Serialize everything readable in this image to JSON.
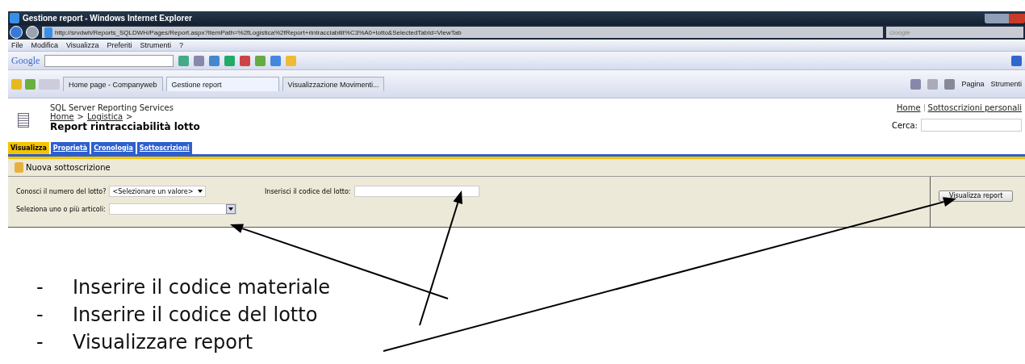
{
  "window": {
    "title": "Gestione report - Windows Internet Explorer"
  },
  "address_bar": {
    "url": "http://srvdwh/Reports_SQLDWH/Pages/Report.aspx?ItemPath=%2fLogistica%2fReport+rintracciabilit%C3%A0+lotto&SelectedTabId=ViewTab",
    "search_placeholder": "Google"
  },
  "menu": [
    "File",
    "Modifica",
    "Visualizza",
    "Preferiti",
    "Strumenti",
    "?"
  ],
  "google_toolbar": {
    "logo": "Google"
  },
  "browser_tabs": [
    {
      "label": "Home page - Companyweb",
      "selected": false
    },
    {
      "label": "Gestione report",
      "selected": true
    },
    {
      "label": "Visualizzazione Movimenti...",
      "selected": false
    }
  ],
  "command_bar": [
    "Pagina",
    "Strumenti"
  ],
  "page": {
    "product": "SQL Server Reporting Services",
    "breadcrumbs": [
      "Home",
      "Logistica"
    ],
    "separator": ">",
    "title": "Report rintracciabilità lotto",
    "top_links": [
      "Home",
      "Sottoscrizioni personali"
    ],
    "search_label": "Cerca:",
    "tabs": [
      {
        "label": "Visualizza",
        "selected": true
      },
      {
        "label": "Proprietà",
        "selected": false
      },
      {
        "label": "Cronologia",
        "selected": false
      },
      {
        "label": "Sottoscrizioni",
        "selected": false
      }
    ],
    "toolbar_action": "Nuova sottoscrizione",
    "parameters": [
      {
        "kind": "dropdown",
        "label": "Conosci il numero del lotto?",
        "value": "<Selezionare un valore>"
      },
      {
        "kind": "text",
        "label": "Inserisci il codice del lotto:"
      },
      {
        "kind": "multiselect",
        "label": "Seleziona uno o più articoli:"
      }
    ],
    "view_button": "Visualizza report"
  },
  "notes": [
    {
      "bullet": "-",
      "text": "Inserire il codice materiale"
    },
    {
      "bullet": "-",
      "text": "Inserire il codice del lotto"
    },
    {
      "bullet": "-",
      "text": "Visualizzare report"
    }
  ]
}
